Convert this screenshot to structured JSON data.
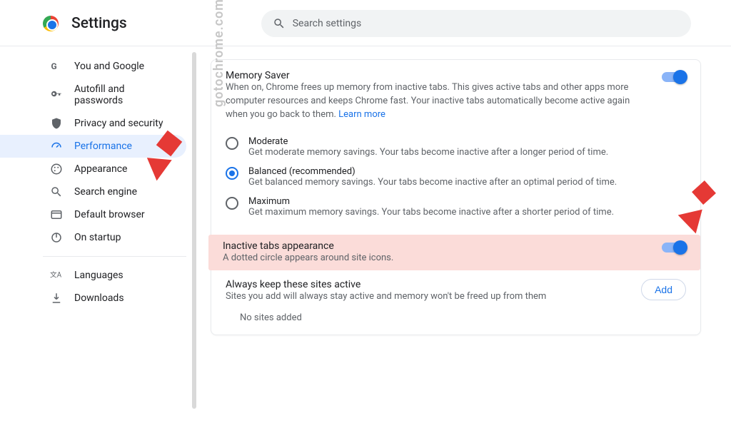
{
  "header": {
    "title": "Settings",
    "search_placeholder": "Search settings"
  },
  "sidebar": {
    "items": [
      {
        "label": "You and Google"
      },
      {
        "label": "Autofill and passwords"
      },
      {
        "label": "Privacy and security"
      },
      {
        "label": "Performance"
      },
      {
        "label": "Appearance"
      },
      {
        "label": "Search engine"
      },
      {
        "label": "Default browser"
      },
      {
        "label": "On startup"
      }
    ],
    "secondary": [
      {
        "label": "Languages"
      },
      {
        "label": "Downloads"
      }
    ]
  },
  "memory_saver": {
    "title": "Memory Saver",
    "description": "When on, Chrome frees up memory from inactive tabs. This gives active tabs and other apps more computer resources and keeps Chrome fast. Your inactive tabs automatically become active again when you go back to them.",
    "learn_more": "Learn more",
    "options": [
      {
        "title": "Moderate",
        "desc": "Get moderate memory savings. Your tabs become inactive after a longer period of time."
      },
      {
        "title": "Balanced (recommended)",
        "desc": "Get balanced memory savings. Your tabs become inactive after an optimal period of time."
      },
      {
        "title": "Maximum",
        "desc": "Get maximum memory savings. Your tabs become inactive after a shorter period of time."
      }
    ]
  },
  "inactive_appearance": {
    "title": "Inactive tabs appearance",
    "desc": "A dotted circle appears around site icons."
  },
  "always_active": {
    "title": "Always keep these sites active",
    "desc": "Sites you add will always stay active and memory won't be freed up from them",
    "add_label": "Add",
    "empty": "No sites added"
  },
  "watermark": "gotochrome.com"
}
